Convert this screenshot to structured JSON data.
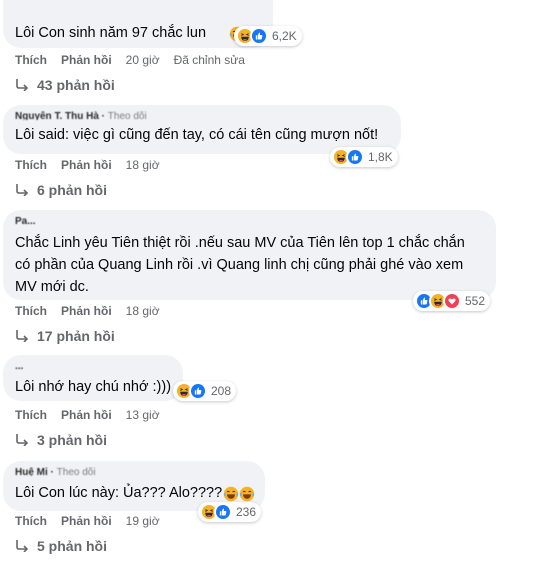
{
  "comments": [
    {
      "author": "",
      "author_extra": "",
      "text": "Lôi Con sinh năm 97 chắc lun",
      "reaction_count": "6,2K",
      "actions": {
        "like": "Thích",
        "reply": "Phản hồi",
        "time": "20 giờ",
        "edited": "Đã chỉnh sửa"
      },
      "replies": "43 phản hồi"
    },
    {
      "author": "Nguyễn T. Thu Hà",
      "author_extra": "Theo dõi",
      "text": "Lôi said: việc gì cũng đến tay, có cái tên cũng mượn nốt!",
      "reaction_count": "1,8K",
      "actions": {
        "like": "Thích",
        "reply": "Phản hồi",
        "time": "18 giờ"
      },
      "replies": "6 phản hồi"
    },
    {
      "author": "Pa...",
      "author_extra": "",
      "text_lines": [
        "Chắc Linh yêu Tiên thiệt rồi .nếu sau MV của Tiên lên top 1 chắc chắn",
        "có phần của Quang Linh rồi .vì Quang linh chị cũng phải ghé vào xem",
        "MV mới dc."
      ],
      "reaction_count": "552",
      "actions": {
        "like": "Thích",
        "reply": "Phản hồi",
        "time": "18 giờ"
      },
      "replies": "17 phản hồi"
    },
    {
      "author": "...",
      "author_extra": "",
      "text": "Lôi nhớ hay chú nhớ :)))",
      "reaction_count": "208",
      "actions": {
        "like": "Thích",
        "reply": "Phản hồi",
        "time": "13 giờ"
      },
      "replies": "3 phản hồi"
    },
    {
      "author": "Huệ Mi",
      "author_extra": "Theo dõi",
      "text": "Lôi Con lúc này: Ủa??? Alo????",
      "reaction_count": "236",
      "actions": {
        "like": "Thích",
        "reply": "Phản hồi",
        "time": "19 giờ"
      },
      "replies": "5 phản hồi"
    }
  ],
  "colors": {
    "bubble": "#f0f2f5",
    "meta": "#65676b",
    "like_blue": "#1877f2",
    "haha_yellow": "#f7b125",
    "love_red": "#f33e58"
  },
  "icons": [
    "haha-icon",
    "like-icon",
    "love-icon",
    "reply-arrow-icon",
    "laughing-tears-emoji"
  ]
}
